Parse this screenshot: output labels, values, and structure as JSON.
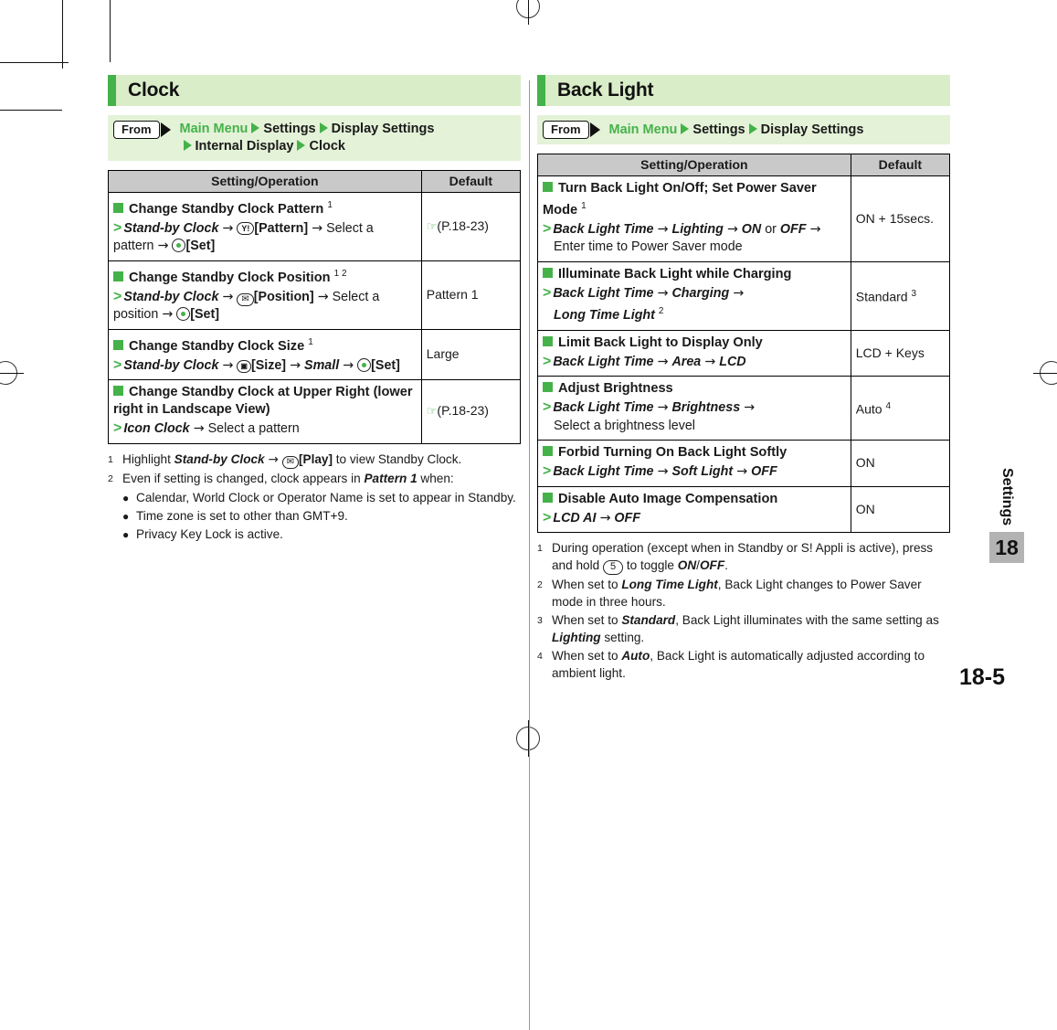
{
  "page": {
    "number": "18-5",
    "side_tab_label": "Settings",
    "side_tab_number": "18"
  },
  "left": {
    "section_title": "Clock",
    "from": {
      "chip_label": "From",
      "path_line1": [
        "Main Menu",
        "Settings",
        "Display Settings"
      ],
      "path_line2": [
        "Internal Display",
        "Clock"
      ]
    },
    "table": {
      "headers": [
        "Setting/Operation",
        "Default"
      ],
      "rows": [
        {
          "heading": "Change Standby Clock Pattern",
          "heading_fn": "1",
          "default": "(P.18-23)",
          "default_is_ref": true
        },
        {
          "heading": "Change Standby Clock Position",
          "heading_fn": "1 2",
          "default": "Pattern 1",
          "default_is_ref": false
        },
        {
          "heading": "Change Standby Clock Size",
          "heading_fn": "1",
          "default": "Large",
          "default_is_ref": false
        },
        {
          "heading": "Change Standby Clock at Upper Right (lower right in Landscape View)",
          "heading_fn": "",
          "default": "(P.18-23)",
          "default_is_ref": true
        }
      ]
    },
    "notes": [
      {
        "num": "1",
        "text": "Highlight Stand-by Clock → [Play] to view Standby Clock."
      },
      {
        "num": "2",
        "text": "Even if setting is changed, clock appears in Pattern 1 when:"
      }
    ],
    "bullets": [
      "Calendar, World Clock or Operator Name is set to appear in Standby.",
      "Time zone is set to other than GMT+9.",
      "Privacy Key Lock is active."
    ]
  },
  "right": {
    "section_title": "Back Light",
    "from": {
      "chip_label": "From",
      "path_line1": [
        "Main Menu",
        "Settings",
        "Display Settings"
      ]
    },
    "table": {
      "headers": [
        "Setting/Operation",
        "Default"
      ],
      "rows": [
        {
          "heading": "Turn Back Light On/Off; Set Power Saver Mode",
          "heading_fn": "1",
          "default": "ON + 15secs."
        },
        {
          "heading": "Illuminate Back Light while Charging",
          "heading_fn": "",
          "default": "Standard",
          "default_fn": "3"
        },
        {
          "heading": "Limit Back Light to Display Only",
          "heading_fn": "",
          "default": "LCD + Keys"
        },
        {
          "heading": "Adjust Brightness",
          "heading_fn": "",
          "default": "Auto",
          "default_fn": "4"
        },
        {
          "heading": "Forbid Turning On Back Light Softly",
          "heading_fn": "",
          "default": "ON"
        },
        {
          "heading": "Disable Auto Image Compensation",
          "heading_fn": "",
          "default": "ON"
        }
      ]
    },
    "notes": [
      {
        "num": "1",
        "text": "During operation (except when in Standby or S! Appli is active), press and hold 5 to toggle ON/OFF."
      },
      {
        "num": "2",
        "text": "When set to Long Time Light, Back Light changes to Power Saver mode in three hours."
      },
      {
        "num": "3",
        "text": "When set to Standard, Back Light illuminates with the same setting as Lighting setting."
      },
      {
        "num": "4",
        "text": "When set to Auto, Back Light is automatically adjusted according to ambient light."
      }
    ]
  },
  "colors": {
    "accent_green": "#45b249",
    "title_bg": "#d9edc8",
    "path_bg": "#e4f2d8",
    "table_header_bg": "#c9c9c9",
    "side_tab_bg": "#b3b3b3"
  },
  "icons": {
    "yahoo_key": "Y!",
    "mail_key": "✉",
    "center_key": "center-select",
    "tv_key": "TV",
    "num5_key": "5"
  }
}
